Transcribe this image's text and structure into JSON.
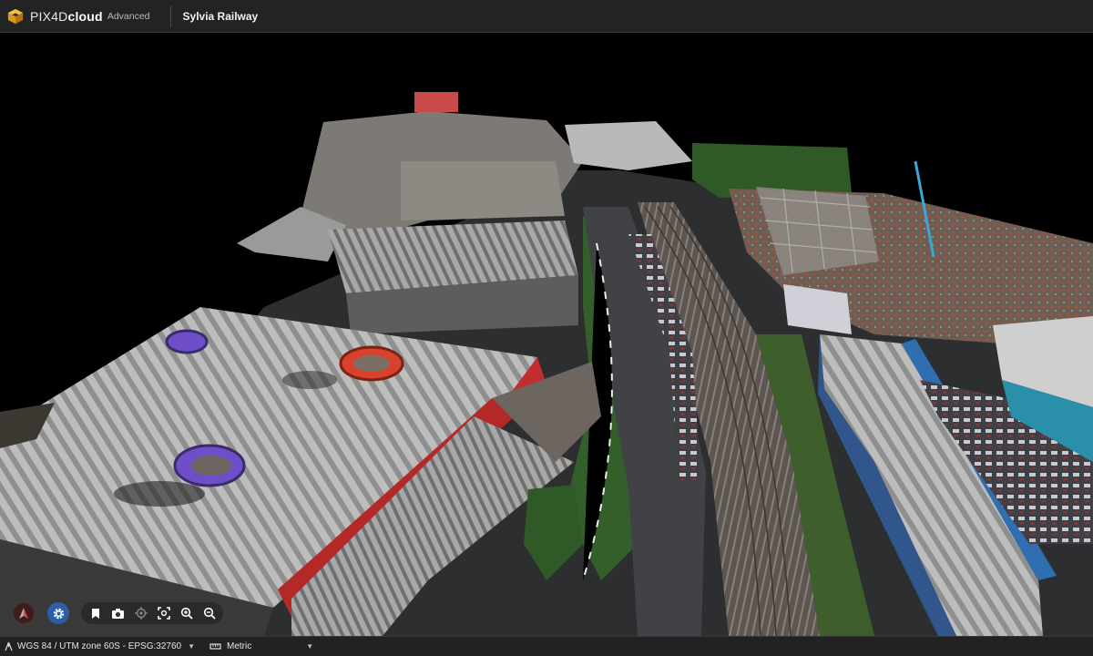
{
  "app": {
    "brand_main": "PIX4D",
    "brand_bold": "cloud",
    "brand_sub": "Advanced",
    "project_title": "Sylvia Railway"
  },
  "viewport": {
    "background": "#000000"
  },
  "toolbar": {
    "compass_icon": "north-arrow-icon",
    "settings_icon": "gear-icon",
    "tools": [
      "bookmark-icon",
      "camera-icon",
      "target-icon",
      "fit-view-icon",
      "zoom-in-icon",
      "zoom-out-icon"
    ]
  },
  "status": {
    "crs": "WGS 84 / UTM zone 60S - EPSG:32760",
    "units": "Metric"
  },
  "colors": {
    "topbar": "#232323",
    "accent_blue": "#2b5fa8",
    "compass_red": "#e04848"
  }
}
